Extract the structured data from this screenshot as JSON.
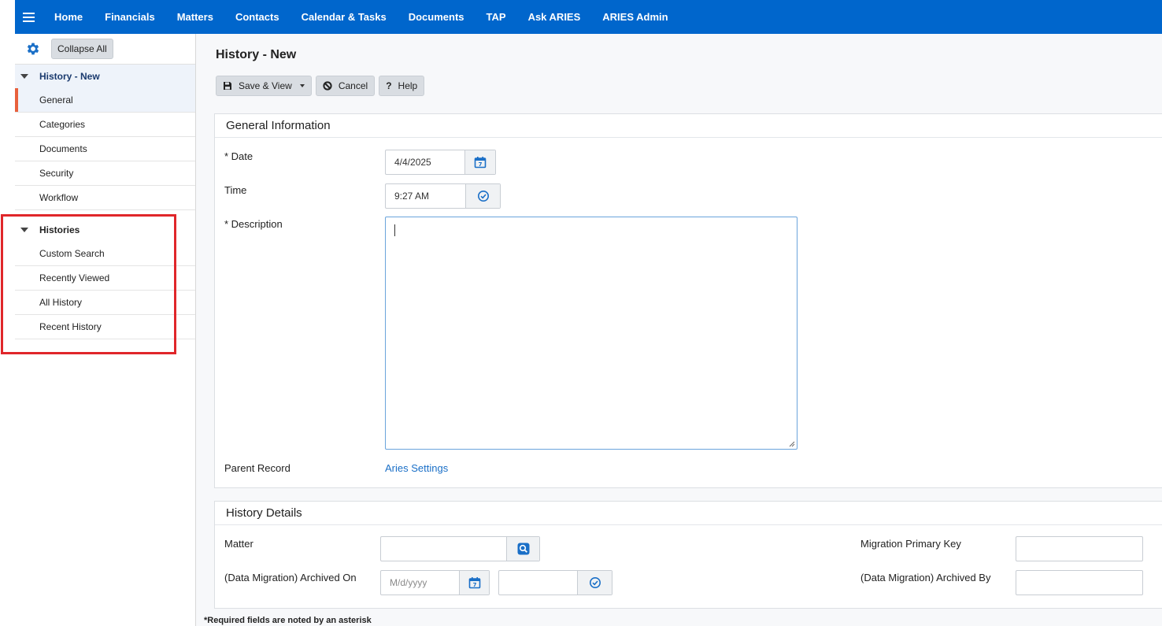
{
  "nav": {
    "items": [
      "Home",
      "Financials",
      "Matters",
      "Contacts",
      "Calendar & Tasks",
      "Documents",
      "TAP",
      "Ask ARIES",
      "ARIES Admin"
    ]
  },
  "sidebar": {
    "collapse_label": "Collapse All",
    "group1": {
      "title": "History - New",
      "items": [
        "General",
        "Categories",
        "Documents",
        "Security",
        "Workflow"
      ]
    },
    "group2": {
      "title": "Histories",
      "items": [
        "Custom Search",
        "Recently Viewed",
        "All History",
        "Recent History"
      ]
    }
  },
  "page": {
    "title": "History - New"
  },
  "toolbar": {
    "save_view": "Save & View",
    "cancel": "Cancel",
    "help": "Help"
  },
  "general": {
    "heading": "General Information",
    "date_label": "* Date",
    "date_value": "4/4/2025",
    "time_label": "Time",
    "time_value": "9:27 AM",
    "description_label": "* Description",
    "parent_label": "Parent Record",
    "parent_link": "Aries Settings"
  },
  "details": {
    "heading": "History Details",
    "matter_label": "Matter",
    "archived_on_label": "(Data Migration) Archived On",
    "archived_on_placeholder": "M/d/yyyy",
    "migration_key_label": "Migration Primary Key",
    "archived_by_label": "(Data Migration) Archived By"
  },
  "footnote": "*Required fields are noted by an asterisk",
  "colors": {
    "nav_bg": "#0066cc",
    "active_marker": "#e8603c",
    "highlight": "#e0262a",
    "link": "#1a6fc7"
  }
}
